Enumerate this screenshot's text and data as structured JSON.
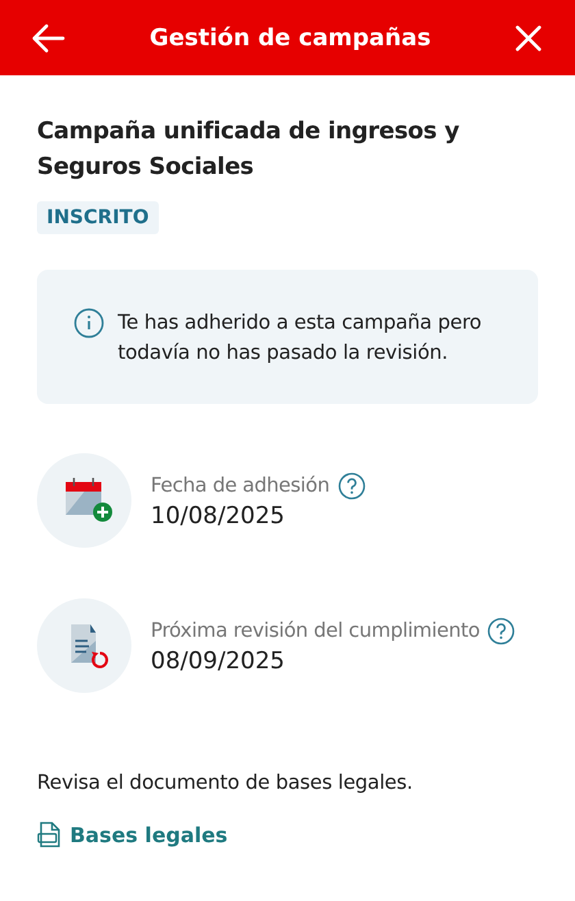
{
  "header": {
    "title": "Gestión de campañas"
  },
  "campaign": {
    "title": "Campaña unificada de ingresos y Seguros Sociales",
    "status": "INSCRITO"
  },
  "notice": {
    "text": "Te has adherido a esta campaña pero todavía no has pasado la revisión."
  },
  "dates": [
    {
      "kind": "calendar",
      "label": "Fecha de adhesión",
      "value": "10/08/2025"
    },
    {
      "kind": "document",
      "label": "Próxima revisión del cumplimiento",
      "value": "08/09/2025"
    }
  ],
  "documents": {
    "text": "Revisa el documento de bases legales.",
    "link": "Bases legales"
  }
}
